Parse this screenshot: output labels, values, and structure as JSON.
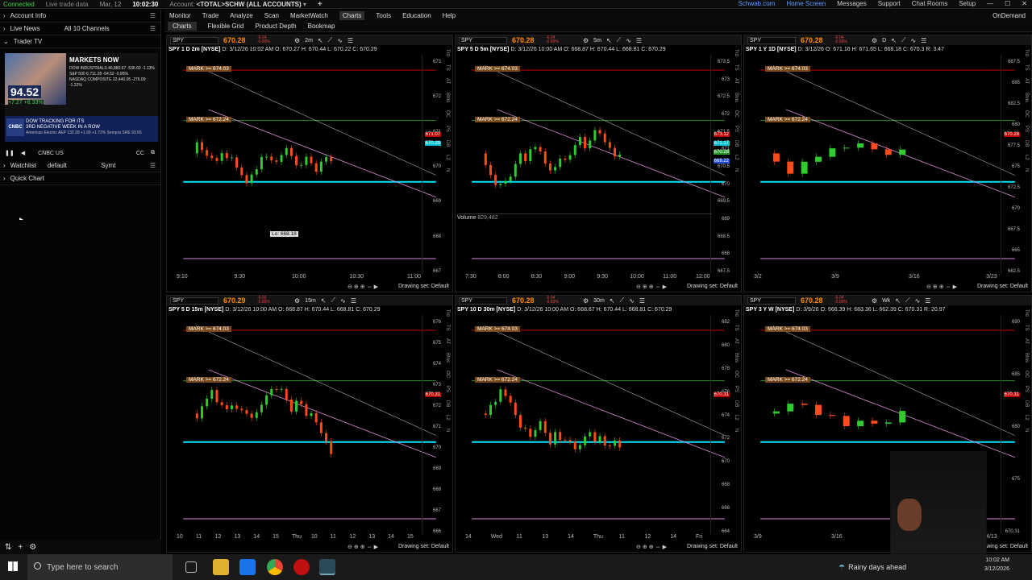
{
  "topbar": {
    "connected": "Connected",
    "live": "Live trade data",
    "datetime": "Mar, 12",
    "time": "10:02:30",
    "account_label": "Account:",
    "account_value": "<TOTAL>SCHW (ALL ACCOUNTS)",
    "links": [
      "Schwab.com",
      "Home Screen",
      "Messages",
      "Support",
      "Chat Rooms",
      "Setup"
    ]
  },
  "left": {
    "account_info": "Account Info",
    "live_news": "Live News",
    "channels": "All 10 Channels",
    "trader_tv": "Trader TV",
    "markets_now": "MARKETS NOW",
    "tv_rows": [
      "DOW INDUSTRIALS  46,880.67  -536.60  -1.13%",
      "S&P 500  6,711.28  -64.52  -0.95%",
      "NASDAQ COMPOSITE  22,440.05  -276.09  -1.22%"
    ],
    "tv_price": "94.52",
    "tv_change": "+7.27 +8.33%",
    "tv_ticker1": "DOW TRACKING FOR ITS",
    "tv_ticker2": "3RD NEGATIVE WEEK IN A ROW",
    "tv_ticker3": "American Electric AEP 132.28 +1.99 +1.72%  Sempra SRE 93.55",
    "cnbc": "CNBC",
    "channel": "CNBC US",
    "watchlist": "Watchlist",
    "watchlist_val": "default",
    "symt": "Symt",
    "quick_chart": "Quick Chart"
  },
  "nav": {
    "items": [
      "Monitor",
      "Trade",
      "Analyze",
      "Scan",
      "MarketWatch",
      "Charts",
      "Tools",
      "Education",
      "Help"
    ],
    "active": "Charts",
    "ondemand": "OnDemand"
  },
  "subnav": {
    "items": [
      "Charts",
      "Flexible Grid",
      "Product Depth",
      "Bookmap"
    ],
    "active": "Charts"
  },
  "panels": [
    {
      "sym": "SPY",
      "price": "670.28",
      "chg1": "-6.04",
      "chg2": "-0.89%",
      "tf": "2m",
      "info": "SPY 1 D 2m [NYSE]",
      "ohlc": "D: 3/12/26 10:02 AM  O: 670.27  H: 670.44  L: 670.22  C: 670.29",
      "yticks": [
        "673",
        "672",
        "671",
        "670",
        "669",
        "668",
        "667"
      ],
      "tags": [
        "671.07",
        "670.29"
      ],
      "xticks": [
        "9:10",
        "9:30",
        "10:00",
        "10:30",
        "11:00"
      ],
      "marks": [
        "MARK >= 674.03",
        "MARK >= 672.24"
      ],
      "lo": "Lo: 668.18",
      "drawing": "Drawing set: Default"
    },
    {
      "sym": "SPY",
      "price": "670.28",
      "chg1": "-6.04",
      "chg2": "-0.89%",
      "tf": "5m",
      "info": "SPY 5 D 5m [NYSE]",
      "ohlc": "D: 3/12/26 10:00 AM  O: 668.87  H: 670.44  L: 668.81  C: 670.29",
      "yticks": [
        "673.5",
        "673",
        "672.5",
        "672",
        "671.5",
        "671",
        "670.5",
        "670",
        "669.5",
        "669",
        "668.5",
        "668",
        "667.5"
      ],
      "tags": [
        "673.12",
        "671.17",
        "670.28",
        "669.22"
      ],
      "xticks": [
        "7:30",
        "8:00",
        "8:30",
        "9:00",
        "9:30",
        "10:00",
        "11:00",
        "12:00"
      ],
      "marks": [
        "MARK >= 674.03",
        "MARK >= 672.24"
      ],
      "volume": "Volume",
      "volume_val": "829,482",
      "vticks": [
        "5",
        "2.5"
      ],
      "drawing": "Drawing set: Default"
    },
    {
      "sym": "SPY",
      "price": "670.28",
      "chg1": "-6.04",
      "chg2": "-0.89%",
      "tf": "D",
      "info": "SPY 1 Y 1D [NYSE]",
      "ohlc": "D: 3/12/26  O: 671.16  H: 671.65  L: 668.18  C: 670.3  R: 3.47",
      "yticks": [
        "687.5",
        "685",
        "682.5",
        "680",
        "677.5",
        "675",
        "672.5",
        "670",
        "667.5",
        "665",
        "662.5"
      ],
      "tags": [
        "670.28"
      ],
      "xticks": [
        "3/2",
        "3/9",
        "3/16",
        "3/23"
      ],
      "marks": [
        "MARK >= 674.03",
        "MARK >= 672.24"
      ],
      "drawing": "Drawing set: Default"
    },
    {
      "sym": "SPY",
      "price": "670.29",
      "chg1": "-6.03",
      "chg2": "-0.89%",
      "tf": "15m",
      "info": "SPY 5 D 15m [NYSE]",
      "ohlc": "D: 3/12/26 10:00 AM  O: 668.87  H: 670.44  L: 668.81  C: 670.29",
      "yticks": [
        "676",
        "675",
        "674",
        "673",
        "672",
        "671",
        "670",
        "669",
        "668",
        "667",
        "666"
      ],
      "tags": [
        "670.31"
      ],
      "xticks": [
        "10",
        "11",
        "12",
        "13",
        "14",
        "15",
        "Thu",
        "10",
        "11",
        "12",
        "13",
        "14",
        "15"
      ],
      "marks": [
        "MARK >= 674.03",
        "MARK >= 672.24"
      ],
      "drawing": "Drawing set: Default"
    },
    {
      "sym": "SPY",
      "price": "670.28",
      "chg1": "-6.04",
      "chg2": "-0.89%",
      "tf": "30m",
      "info": "SPY 10 D 30m [NYSE]",
      "ohlc": "D: 3/12/26 10:00 AM  O: 668.87  H: 670.44  L: 668.81  C: 670.29",
      "yticks": [
        "682",
        "680",
        "678",
        "676",
        "674",
        "672",
        "670",
        "668",
        "666",
        "664"
      ],
      "tags": [
        "670.31"
      ],
      "xticks": [
        "14",
        "Wed",
        "11",
        "13",
        "14",
        "Thu",
        "11",
        "12",
        "14",
        "Fri"
      ],
      "marks": [
        "MARK >= 674.03",
        "MARK >= 672.24"
      ],
      "drawing": "Drawing set: Default"
    },
    {
      "sym": "SPY",
      "price": "670.28",
      "chg1": "-6.04",
      "chg2": "-0.89%",
      "tf": "Wk",
      "info": "SPY 3 Y W [NYSE]",
      "ohlc": "D: 3/9/26  O: 666.39  H: 683.36  L: 662.39  C: 670.31  R: 20.97",
      "yticks": [
        "690",
        "685",
        "680",
        "675",
        "670.31"
      ],
      "tags": [
        "670.31"
      ],
      "xticks": [
        "3/9",
        "3/16",
        "4/6",
        "4/13"
      ],
      "marks": [
        "MARK >= 674.03",
        "MARK >= 672.24"
      ],
      "drawing": "Drawing set: Default"
    }
  ],
  "side_labels": [
    "Trd",
    "TS",
    "AT",
    "Btns",
    "OC",
    "PS",
    "DB",
    "L2",
    "N"
  ],
  "taskbar": {
    "search": "Type here to search",
    "weather": "Rainy days ahead",
    "time": "10:02 AM",
    "date": "3/12/2026"
  },
  "colors": {
    "cyan": "#00e5ff",
    "magenta": "#d98ad9",
    "green_bar": "#2ecc2e",
    "red_bar": "#ff4a1a",
    "gray_line": "#b0b0b0",
    "red_line": "#c00000",
    "accent_orange": "#ff8a00"
  }
}
